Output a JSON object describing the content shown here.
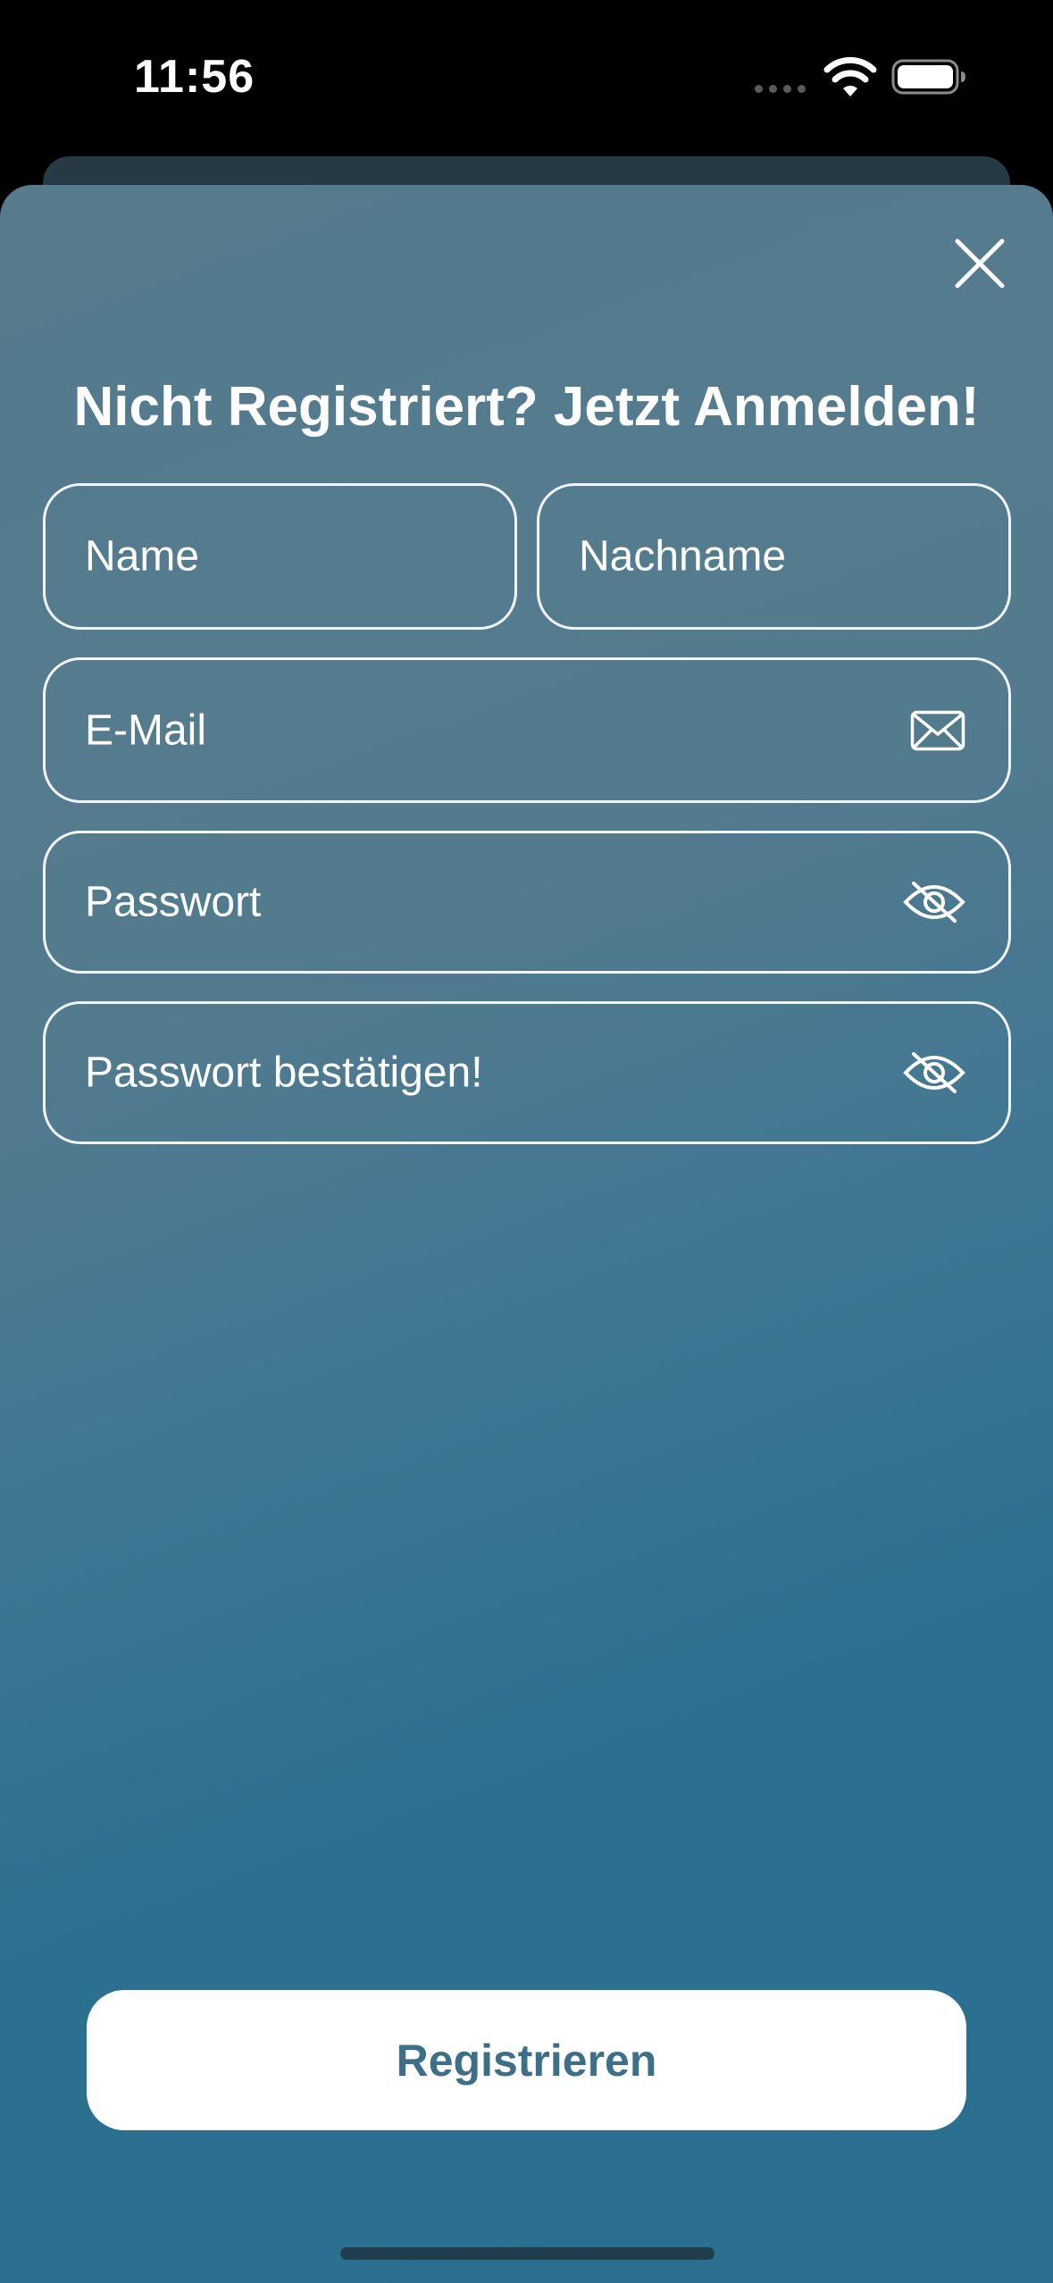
{
  "status_bar": {
    "time": "11:56",
    "wifi_icon": "wifi-icon",
    "battery_icon": "battery-icon"
  },
  "sheet": {
    "close_icon": "close-icon",
    "title": "Nicht Registriert? Jetzt Anmelden!",
    "fields": {
      "name": {
        "placeholder": "Name",
        "value": ""
      },
      "lastname": {
        "placeholder": "Nachname",
        "value": ""
      },
      "email": {
        "placeholder": "E-Mail",
        "value": "",
        "icon": "envelope-icon"
      },
      "password": {
        "placeholder": "Passwort",
        "value": "",
        "icon": "eye-slash-icon"
      },
      "confirm_password": {
        "placeholder": "Passwort bestätigen!",
        "value": "",
        "icon": "eye-slash-icon"
      }
    },
    "register_button": "Registrieren"
  },
  "colors": {
    "gradient_top": "#557b8d",
    "gradient_bottom": "#2a6f8f",
    "button_text": "#3e6f88",
    "field_border": "#f2f5f7"
  }
}
